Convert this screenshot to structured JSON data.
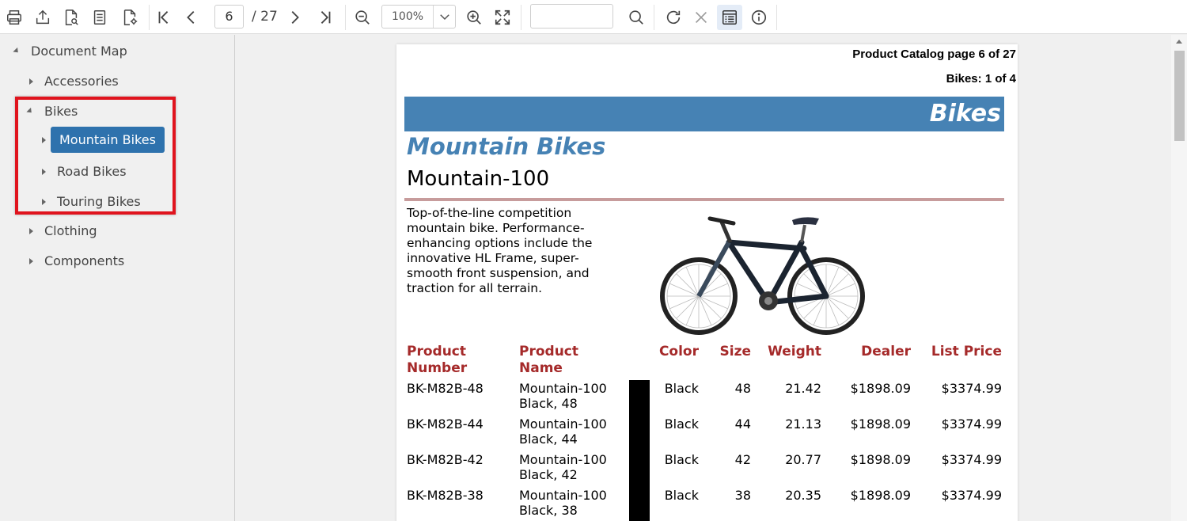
{
  "toolbar": {
    "current_page": "6",
    "total_pages": "/ 27",
    "zoom": "100%",
    "search_value": ""
  },
  "sidebar": {
    "root": "Document Map",
    "items": [
      "Accessories",
      "Bikes",
      "Mountain Bikes",
      "Road Bikes",
      "Touring Bikes",
      "Clothing",
      "Components"
    ]
  },
  "report": {
    "header_line1": "Product Catalog page 6 of 27",
    "header_line2": "Bikes: 1 of 4",
    "band_title": "Bikes",
    "category": "Mountain Bikes",
    "product": "Mountain-100",
    "description": "Top-of-the-line competition mountain bike. Performance-enhancing options include the innovative HL Frame, super-smooth front suspension, and traction for all terrain.",
    "columns": {
      "number": [
        "Product",
        "Number"
      ],
      "name": [
        "Product",
        "Name"
      ],
      "color": "Color",
      "size": "Size",
      "weight": "Weight",
      "dealer": "Dealer",
      "list": "List Price"
    },
    "rows": [
      {
        "number": "BK-M82B-48",
        "name1": "Mountain-100",
        "name2": "Black, 48",
        "color": "Black",
        "size": "48",
        "weight": "21.42",
        "dealer": "$1898.09",
        "list": "$3374.99"
      },
      {
        "number": "BK-M82B-44",
        "name1": "Mountain-100",
        "name2": "Black, 44",
        "color": "Black",
        "size": "44",
        "weight": "21.13",
        "dealer": "$1898.09",
        "list": "$3374.99"
      },
      {
        "number": "BK-M82B-42",
        "name1": "Mountain-100",
        "name2": "Black, 42",
        "color": "Black",
        "size": "42",
        "weight": "20.77",
        "dealer": "$1898.09",
        "list": "$3374.99"
      },
      {
        "number": "BK-M82B-38",
        "name1": "Mountain-100",
        "name2": "Black, 38",
        "color": "Black",
        "size": "38",
        "weight": "20.35",
        "dealer": "$1898.09",
        "list": "$3374.99"
      }
    ]
  },
  "colors": {
    "band": "#4682b4",
    "header_text": "#a52a2a",
    "selected": "#2e72ad",
    "highlight": "#e0141e"
  }
}
